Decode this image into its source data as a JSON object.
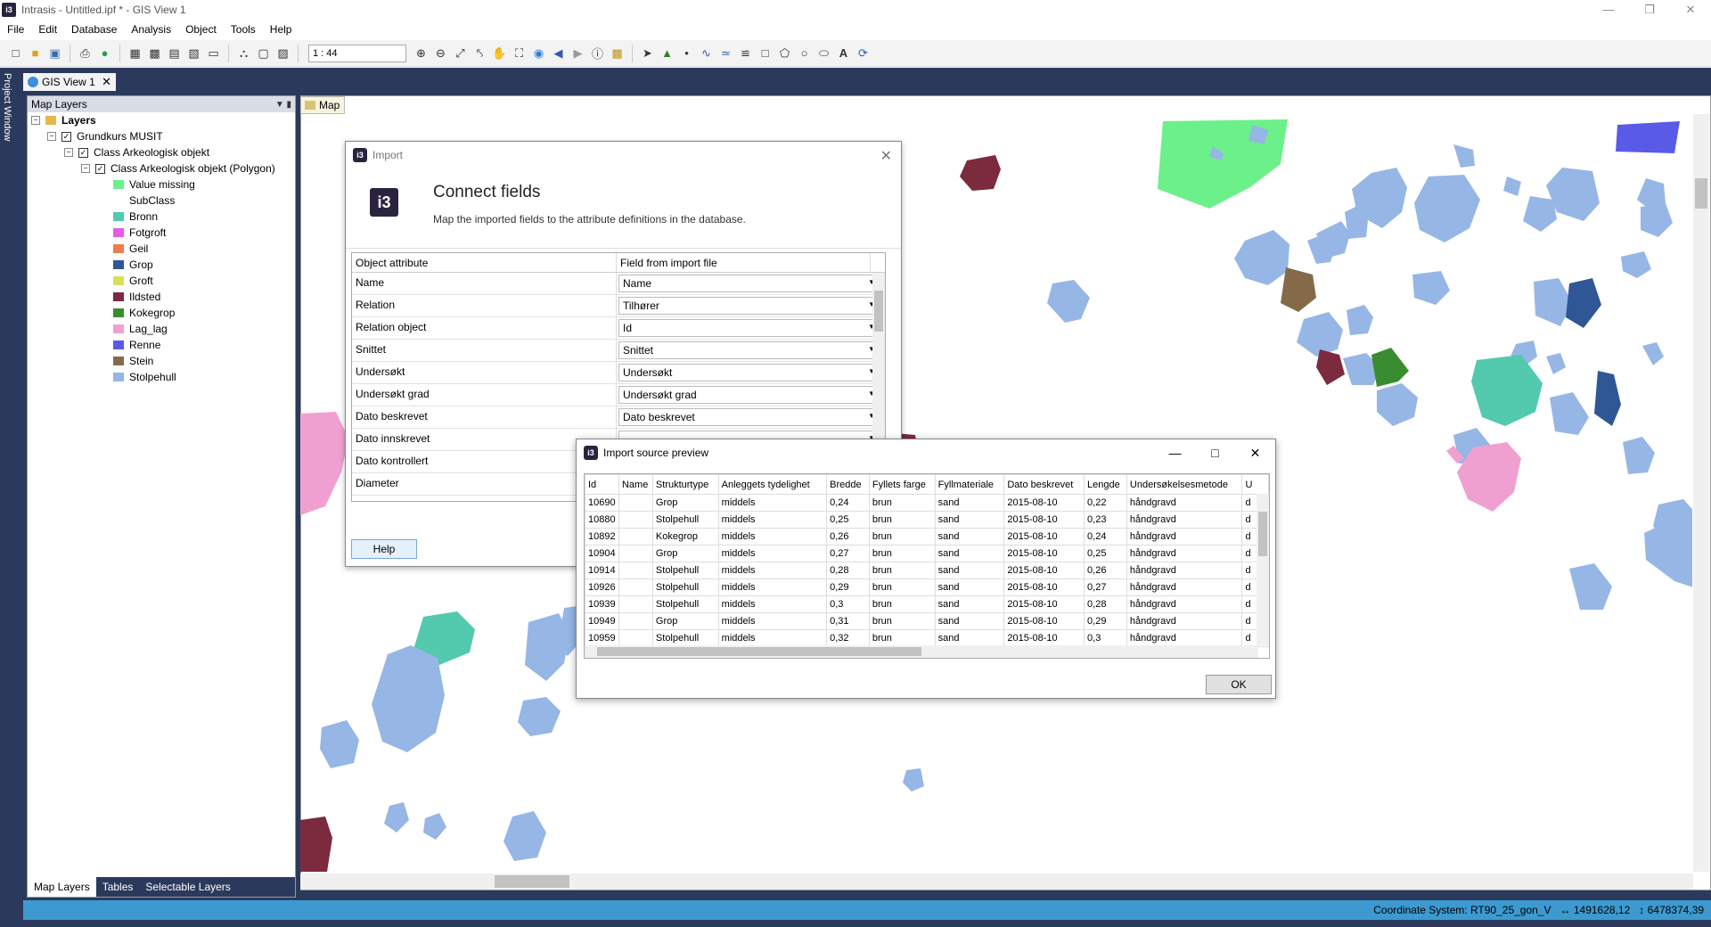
{
  "window": {
    "title": "Intrasis - Untitled.ipf * - GIS View 1",
    "app_icon": "i3"
  },
  "menu": [
    "File",
    "Edit",
    "Database",
    "Analysis",
    "Object",
    "Tools",
    "Help"
  ],
  "toolbar": {
    "scale": "1 : 44"
  },
  "project_window": {
    "label": "Project Window"
  },
  "doc_tab": {
    "label": "GIS View 1"
  },
  "layers": {
    "header": "Map Layers",
    "root": "Layers",
    "group": "Grundkurs MUSIT",
    "class": "Class Arkeologisk objekt",
    "subclass": "Class Arkeologisk objekt (Polygon)",
    "items": [
      {
        "label": "Value missing",
        "color": "#6cf08a"
      },
      {
        "label": "SubClass",
        "color": ""
      },
      {
        "label": "Bronn",
        "color": "#53c9ae"
      },
      {
        "label": "Fotgroft",
        "color": "#e65ce6"
      },
      {
        "label": "Geil",
        "color": "#ee7d4a"
      },
      {
        "label": "Grop",
        "color": "#2f5796"
      },
      {
        "label": "Groft",
        "color": "#d8e05a"
      },
      {
        "label": "Ildsted",
        "color": "#7c2a3e"
      },
      {
        "label": "Kokegrop",
        "color": "#3a8c30"
      },
      {
        "label": "Lag_lag",
        "color": "#f0a0d0"
      },
      {
        "label": "Renne",
        "color": "#5a5ae8"
      },
      {
        "label": "Stein",
        "color": "#856a4a"
      },
      {
        "label": "Stolpehull",
        "color": "#96b6e6"
      }
    ],
    "tabs": [
      "Map Layers",
      "Tables",
      "Selectable Layers"
    ]
  },
  "map": {
    "tab_label": "Map"
  },
  "status": {
    "coordinate_system": "Coordinate System: RT90_25_gon_V",
    "x": "1491628,12",
    "y": "6478374,39"
  },
  "import_dialog": {
    "title": "Import",
    "logo": "i3",
    "heading": "Connect fields",
    "subheading": "Map the imported fields to the attribute definitions in the database.",
    "col_attr": "Object attribute",
    "col_field": "Field from import file",
    "rows": [
      {
        "attr": "Name",
        "field": "Name"
      },
      {
        "attr": "Relation",
        "field": "Tilhører"
      },
      {
        "attr": "Relation object",
        "field": "Id"
      },
      {
        "attr": "Snittet",
        "field": "Snittet"
      },
      {
        "attr": "Undersøkt",
        "field": "Undersøkt"
      },
      {
        "attr": "Undersøkt grad",
        "field": "Undersøkt grad"
      },
      {
        "attr": "Dato beskrevet",
        "field": "Dato beskrevet"
      },
      {
        "attr": "Dato innskrevet",
        "field": ""
      },
      {
        "attr": "Dato kontrollert",
        "field": ""
      },
      {
        "attr": "Diameter",
        "field": ""
      }
    ],
    "help_label": "Help"
  },
  "preview_dialog": {
    "title": "Import source preview",
    "columns": [
      "Id",
      "Name",
      "Strukturtype",
      "Anleggets tydelighet",
      "Bredde",
      "Fyllets farge",
      "Fyllmateriale",
      "Dato beskrevet",
      "Lengde",
      "Undersøkelsesmetode",
      "U"
    ],
    "rows": [
      [
        "10690",
        "",
        "Grop",
        "middels",
        "0,24",
        "brun",
        "sand",
        "2015-08-10",
        "0,22",
        "håndgravd",
        "d"
      ],
      [
        "10880",
        "",
        "Stolpehull",
        "middels",
        "0,25",
        "brun",
        "sand",
        "2015-08-10",
        "0,23",
        "håndgravd",
        "d"
      ],
      [
        "10892",
        "",
        "Kokegrop",
        "middels",
        "0,26",
        "brun",
        "sand",
        "2015-08-10",
        "0,24",
        "håndgravd",
        "d"
      ],
      [
        "10904",
        "",
        "Grop",
        "middels",
        "0,27",
        "brun",
        "sand",
        "2015-08-10",
        "0,25",
        "håndgravd",
        "d"
      ],
      [
        "10914",
        "",
        "Stolpehull",
        "middels",
        "0,28",
        "brun",
        "sand",
        "2015-08-10",
        "0,26",
        "håndgravd",
        "d"
      ],
      [
        "10926",
        "",
        "Stolpehull",
        "middels",
        "0,29",
        "brun",
        "sand",
        "2015-08-10",
        "0,27",
        "håndgravd",
        "d"
      ],
      [
        "10939",
        "",
        "Stolpehull",
        "middels",
        "0,3",
        "brun",
        "sand",
        "2015-08-10",
        "0,28",
        "håndgravd",
        "d"
      ],
      [
        "10949",
        "",
        "Grop",
        "middels",
        "0,31",
        "brun",
        "sand",
        "2015-08-10",
        "0,29",
        "håndgravd",
        "d"
      ],
      [
        "10959",
        "",
        "Stolpehull",
        "middels",
        "0,32",
        "brun",
        "sand",
        "2015-08-10",
        "0,3",
        "håndgravd",
        "d"
      ]
    ],
    "ok_label": "OK"
  }
}
